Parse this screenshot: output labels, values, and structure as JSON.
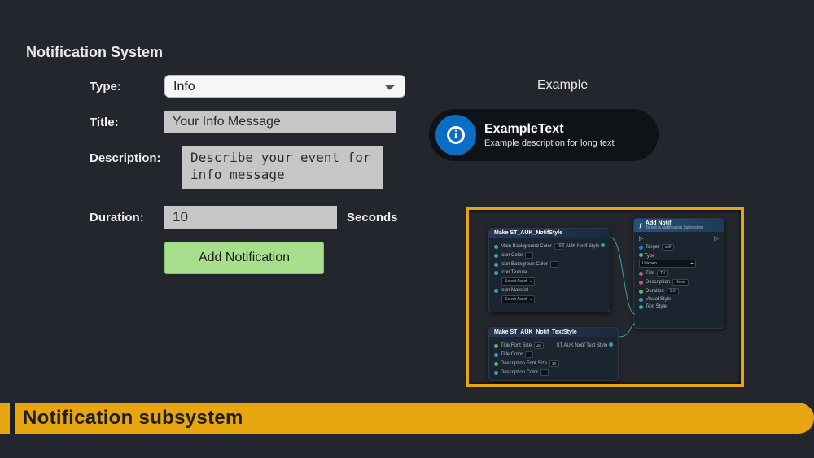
{
  "page": {
    "title": "Notification System"
  },
  "form": {
    "type_label": "Type:",
    "type_value": "Info",
    "title_label": "Title:",
    "title_value": "Your Info Message",
    "desc_label": "Description:",
    "desc_value": "Describe your event for info message",
    "duration_label": "Duration:",
    "duration_value": "10",
    "seconds_label": "Seconds",
    "add_button": "Add Notification"
  },
  "example": {
    "heading": "Example",
    "title": "ExampleText",
    "description": "Example description for long text"
  },
  "blueprint": {
    "node_style": {
      "header": "Make ST_AUK_NotifStyle",
      "output": "ST AUK Notif Style",
      "pins": [
        "Main Background Color",
        "Icon Color",
        "Icon Backgroun Color",
        "Icon Texture",
        "Icon Material"
      ],
      "selects": [
        "Select Asset",
        "Select Asset"
      ]
    },
    "node_text": {
      "header": "Make ST_AUK_Notif_TextStyle",
      "output": "ST AUK Notif Text Style",
      "pins": [
        "Title Font Size",
        "Title Color",
        "Description Font Size",
        "Description Color"
      ],
      "values": [
        "40",
        "30"
      ]
    },
    "node_add": {
      "header": "Add Notif",
      "sub": "Target is Notification Subsystem",
      "pins": [
        "Target",
        "Type",
        "Title",
        "Description",
        "Duration",
        "Visual Style",
        "Text Style"
      ],
      "target_val": "self",
      "type_val": "Unkown",
      "title_val": "Ttl",
      "desc_val": "None",
      "dur_val": "5.0"
    }
  },
  "footer": {
    "title": "Notification subsystem"
  }
}
